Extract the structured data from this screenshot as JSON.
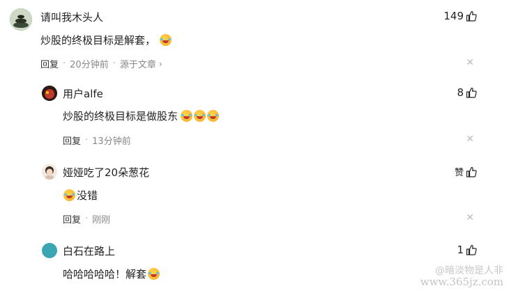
{
  "comments": [
    {
      "name": "请叫我木头人",
      "likes": "149",
      "text": "炒股的终极目标是解套，",
      "reply": "回复",
      "time": "20分钟前",
      "source": "源于文章",
      "avatar_color": "#2f3a2e"
    },
    {
      "name": "用户alfe",
      "likes": "8",
      "text": "炒股的终极目标是做股东",
      "reply": "回复",
      "time": "13分钟前",
      "avatar_color": "#8b1a1a"
    },
    {
      "name": "娅娅吃了20朵葱花",
      "likes": "赞",
      "text": "没错",
      "reply": "回复",
      "time": "刚刚",
      "avatar_color": "#e9dccf"
    },
    {
      "name": "白石在路上",
      "likes": "1",
      "text": "哈哈哈哈哈！解套",
      "avatar_color": "#3aa6b3"
    }
  ],
  "watermark": {
    "line1": "@暗淡物是人非",
    "line2": "www.365jz.com"
  },
  "icons": {
    "thumb": "thumbs-up-icon",
    "close": "close-icon",
    "chevron": "chevron-right-icon",
    "emoji": "laughing-tears-emoji"
  }
}
